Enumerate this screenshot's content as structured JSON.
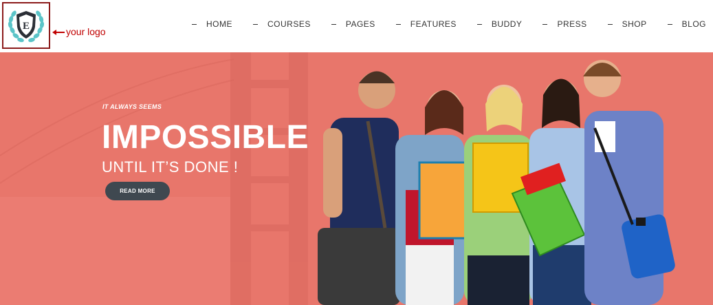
{
  "header": {
    "logo_annotation": "your logo",
    "logo_letter": "E",
    "nav": [
      {
        "label": "HOME"
      },
      {
        "label": "COURSES"
      },
      {
        "label": "PAGES"
      },
      {
        "label": "FEATURES"
      },
      {
        "label": "BUDDY"
      },
      {
        "label": "PRESS"
      },
      {
        "label": "SHOP"
      },
      {
        "label": "BLOG"
      }
    ]
  },
  "hero": {
    "kicker": "IT ALWAYS SEEMS",
    "title": "IMPOSSIBLE",
    "subtitle": "UNTIL IT’S DONE !",
    "cta_label": "READ MORE",
    "background_color": "#e8766b",
    "image": "group-of-students-photo"
  },
  "colors": {
    "annotation_red": "#c00000",
    "button_dark": "#3f4850",
    "logo_teal": "#5bc4c8",
    "shield_dark": "#2b2f36"
  }
}
